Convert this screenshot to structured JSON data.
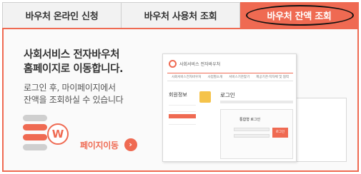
{
  "tabs": [
    {
      "label": "바우처 온라인 신청"
    },
    {
      "label": "바우처 사용처 조회"
    },
    {
      "label": "바우처 잔액 조회"
    }
  ],
  "panel": {
    "title_line1": "사회서비스 전자바우처",
    "title_line2": "홈페이지로 이동합니다.",
    "desc_line1": "로그인 후, 마이페이지에서",
    "desc_line2": "잔액을 조회하실 수 있습니다",
    "logo_letter": "W",
    "move_label": "페이지이동",
    "move_icon": "›"
  },
  "mock": {
    "site_name": "사회서비스 전자바우처",
    "nav": [
      "사회서비스전자바우처",
      "사업별소개",
      "서비스기관찾기",
      "제공기관·지자체 및 협력"
    ],
    "side_title": "회원정보",
    "login_title": "로그인",
    "box_title": "통합형 로그인",
    "button": "로그인"
  },
  "colors": {
    "accent": "#ef6a52",
    "tab_bg": "#f2f2f2"
  }
}
